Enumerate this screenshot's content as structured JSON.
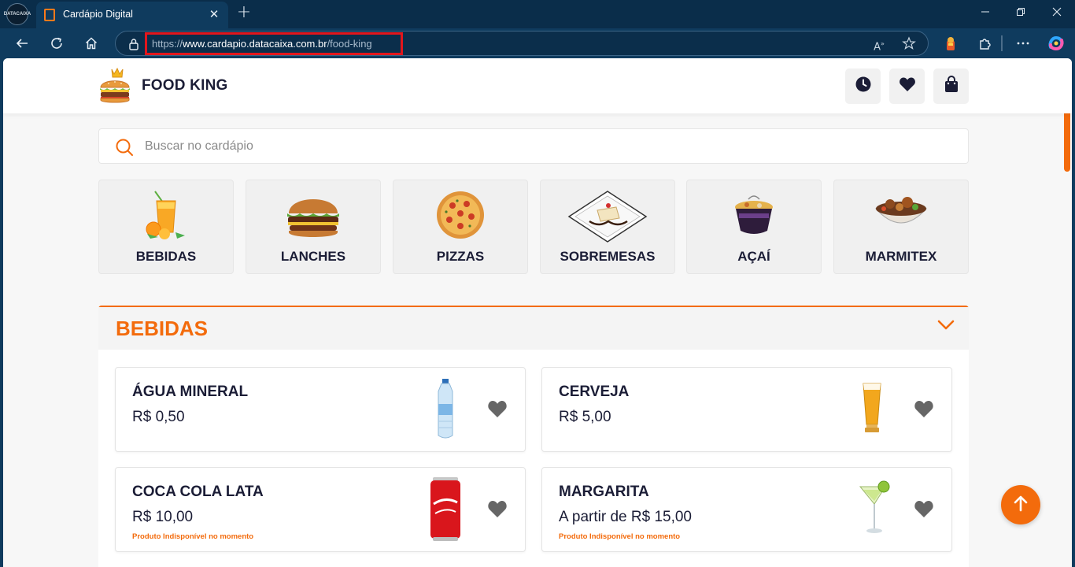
{
  "browser": {
    "profile_label": "DATACAIXA",
    "tab_title": "Cardápio Digital",
    "url": {
      "protocol": "https://",
      "host": "www.cardapio.datacaixa.com.br",
      "path": "/food-king"
    }
  },
  "header": {
    "brand_name": "FOOD KING"
  },
  "search": {
    "placeholder": "Buscar no cardápio"
  },
  "categories": [
    {
      "label": "BEBIDAS"
    },
    {
      "label": "LANCHES"
    },
    {
      "label": "PIZZAS"
    },
    {
      "label": "SOBREMESAS"
    },
    {
      "label": "AÇAÍ"
    },
    {
      "label": "MARMITEX"
    }
  ],
  "section": {
    "title": "BEBIDAS",
    "products": [
      {
        "name": "ÁGUA MINERAL",
        "price": "R$ 0,50",
        "warning": ""
      },
      {
        "name": "CERVEJA",
        "price": "R$ 5,00",
        "warning": ""
      },
      {
        "name": "COCA COLA LATA",
        "price": "R$ 10,00",
        "warning": "Produto Indisponível no momento"
      },
      {
        "name": "MARGARITA",
        "price": "A partir de R$ 15,00",
        "warning": "Produto Indisponível no momento"
      }
    ]
  },
  "colors": {
    "accent": "#f36b0c",
    "text_dark": "#1b1d36",
    "browser_frame": "#0f3b5e",
    "url_highlight": "#e2161c"
  }
}
